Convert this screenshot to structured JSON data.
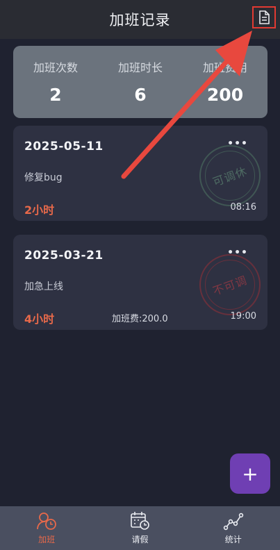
{
  "header": {
    "title": "加班记录",
    "doc_icon": "document-icon"
  },
  "summary": {
    "items": [
      {
        "label": "加班次数",
        "value": "2"
      },
      {
        "label": "加班时长",
        "value": "6"
      },
      {
        "label": "加班费用",
        "value": "200"
      }
    ]
  },
  "records": [
    {
      "date": "2025-05-11",
      "desc": "修复bug",
      "hours": "2小时",
      "time": "08:16",
      "fee": "",
      "stamp": "可调休",
      "more": "•••"
    },
    {
      "date": "2025-03-21",
      "desc": "加急上线",
      "hours": "4小时",
      "time": "19:00",
      "fee": "加班费:200.0",
      "stamp": "不可调",
      "more": "•••"
    }
  ],
  "fab": {
    "label": "+"
  },
  "tabs": [
    {
      "label": "加班",
      "icon": "overtime-icon",
      "active": true
    },
    {
      "label": "请假",
      "icon": "calendar-clock-icon",
      "active": false
    },
    {
      "label": "统计",
      "icon": "line-chart-icon",
      "active": false
    }
  ],
  "colors": {
    "accent": "#e8694a",
    "fab": "#6f3fb3",
    "highlight": "#e23a32"
  }
}
